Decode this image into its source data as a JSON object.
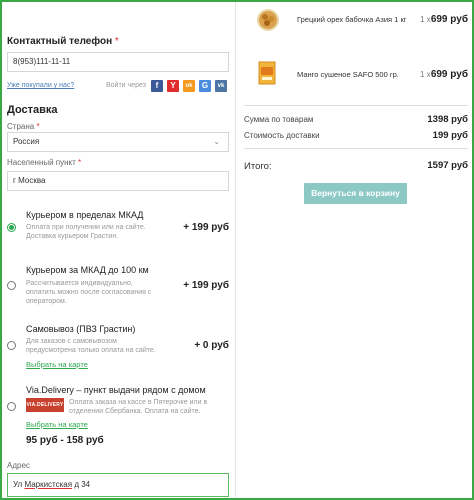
{
  "contact": {
    "phone_label": "Контактный телефон",
    "required_mark": "*",
    "phone_value": "8(953)111-11-11",
    "already_bought_link": "Уже покупали у нас?",
    "login_via": "Войти через",
    "social_icons": [
      {
        "icon": "facebook-icon",
        "glyph": "f",
        "color": "#3b5998"
      },
      {
        "icon": "yandex-icon",
        "glyph": "Y",
        "color": "#e02c2c"
      },
      {
        "icon": "odnoklassniki-icon",
        "glyph": "ok",
        "color": "#f59a1f"
      },
      {
        "icon": "google-icon",
        "glyph": "G",
        "color": "#4a8be0"
      },
      {
        "icon": "vk-icon",
        "glyph": "vk",
        "color": "#4c75a3"
      }
    ]
  },
  "delivery": {
    "title": "Доставка",
    "country_label": "Страна",
    "country_value": "Россия",
    "city_label": "Населенный пункт",
    "city_value": "г Москва",
    "options": [
      {
        "title": "Курьером в пределах МКАД",
        "desc": "Оплата при получении или на сайте. Доставка курьером Грастин.",
        "price": "+ 199 руб",
        "selected": true
      },
      {
        "title": "Курьером за МКАД до 100 км",
        "desc": "Рассчитывается индивидуально, оплатить можно после согласования с оператором.",
        "price": "+ 199 руб",
        "selected": false
      },
      {
        "title": "Самовывоз (ПВЗ Грастин)",
        "desc": "Для заказов с самовывозом предусмотрена только оплата на сайте.",
        "link": "Выбрать на карте",
        "price": "+ 0 руб",
        "selected": false
      },
      {
        "title": "Via.Delivery – пункт выдачи рядом с домом",
        "logo_text": "VIA.DELIVERY",
        "desc": "Оплата заказа на кассе в Пятерочке или в отделении Сбербанка. Оплата на сайте.",
        "link": "Выбрать на карте",
        "price": "95 руб - 158 руб",
        "selected": false
      }
    ],
    "address_label": "Адрес",
    "address_value_prefix": "Ул ",
    "address_value_underlined": "Маркистская",
    "address_value_suffix": " д 34"
  },
  "cart": {
    "items": [
      {
        "name": "Грецкий орех бабочка Азия 1 кг",
        "qty": "1 x",
        "price": "699 руб",
        "icon": "walnut-icon"
      },
      {
        "name": "Манго сушеное SAFO 500 гр.",
        "qty": "1 x",
        "price": "699 руб",
        "icon": "mango-package-icon"
      }
    ],
    "subtotal_label": "Сумма по товарам",
    "subtotal_value": "1398 руб",
    "shipping_label": "Стоимость доставки",
    "shipping_value": "199 руб",
    "total_label": "Итого:",
    "total_value": "1597 руб",
    "back_button": "Вернуться в корзину"
  }
}
